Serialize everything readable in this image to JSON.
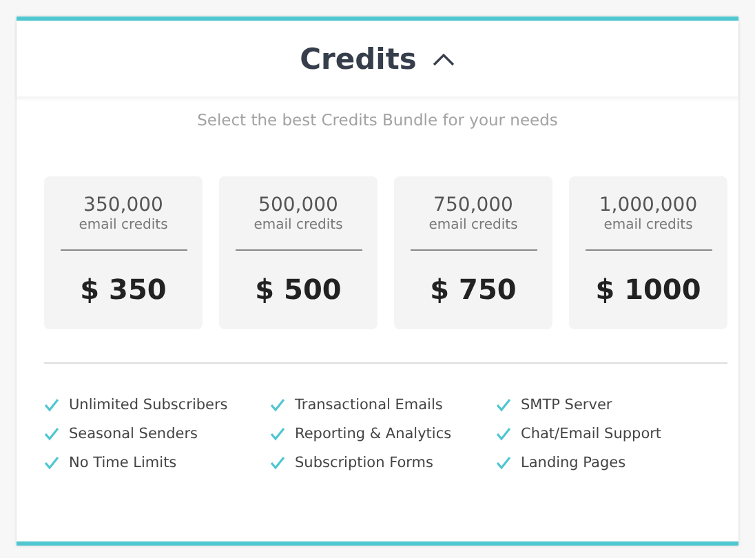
{
  "panel": {
    "title": "Credits",
    "expanded": true,
    "subtitle": "Select the best Credits Bundle for your needs"
  },
  "bundles": [
    {
      "amount": "350,000",
      "unit": "email credits",
      "price": "$ 350"
    },
    {
      "amount": "500,000",
      "unit": "email credits",
      "price": "$ 500"
    },
    {
      "amount": "750,000",
      "unit": "email credits",
      "price": "$ 750"
    },
    {
      "amount": "1,000,000",
      "unit": "email credits",
      "price": "$ 1000"
    }
  ],
  "features": [
    "Unlimited Subscribers",
    "Transactional Emails",
    "SMTP Server",
    "Seasonal Senders",
    "Reporting & Analytics",
    "Chat/Email Support",
    "No Time Limits",
    "Subscription Forms",
    "Landing Pages"
  ]
}
